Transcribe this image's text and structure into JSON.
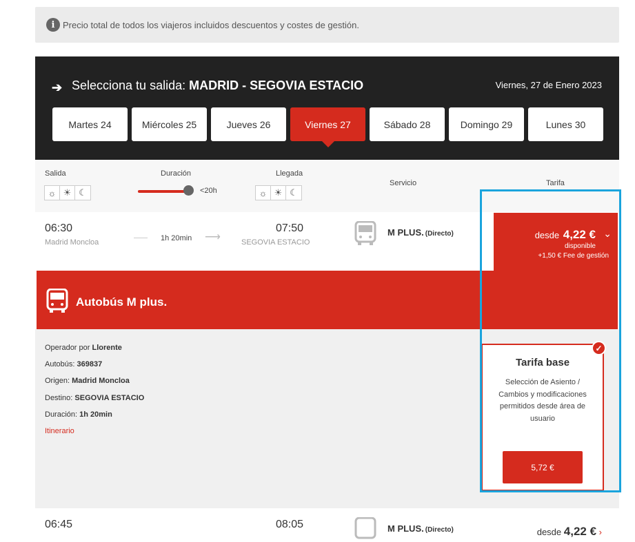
{
  "notice": {
    "icon": "info-icon",
    "text": "Precio total de todos los viajeros incluidos descuentos y costes de gestión."
  },
  "header": {
    "title_prefix": "Selecciona tu salida:",
    "title_route": "MADRID - SEGOVIA ESTACIO",
    "date": "Viernes, 27 de Enero 2023",
    "tabs": [
      {
        "label": "Martes 24"
      },
      {
        "label": "Miércoles 25"
      },
      {
        "label": "Jueves 26"
      },
      {
        "label": "Viernes 27"
      },
      {
        "label": "Sábado 28"
      },
      {
        "label": "Domingo 29"
      },
      {
        "label": "Lunes 30"
      }
    ],
    "active_tab": "Viernes 27"
  },
  "filters": {
    "salida": "Salida",
    "duracion": "Duración",
    "duracion_value": "<20h",
    "llegada": "Llegada",
    "servicio": "Servicio",
    "tarifa": "Tarifa"
  },
  "trip1": {
    "dep_time": "06:30",
    "dep_place": "Madrid Moncloa",
    "duration": "1h 20min",
    "arr_time": "07:50",
    "arr_place": "SEGOVIA ESTACIO",
    "service": "M PLUS.",
    "service_type": "(Directo)",
    "price_prefix": "desde",
    "price": "4,22 €",
    "availability": "disponible",
    "fee": "+1,50 € Fee de gestión"
  },
  "banner": {
    "label": "Autobús M plus."
  },
  "details": {
    "operator_label": "Operador por",
    "operator": "Llorente",
    "bus_label": "Autobús:",
    "bus": "369837",
    "origin_label": "Origen:",
    "origin": "Madrid Moncloa",
    "dest_label": "Destino:",
    "dest": "SEGOVIA ESTACIO",
    "dur_label": "Duración:",
    "dur": "1h 20min",
    "itinerary": "Itinerario"
  },
  "fare_card": {
    "title": "Tarifa base",
    "description": "Selección de Asiento / Cambios y modificaciones permitidos desde área de usuario",
    "price_button": "5,72 €"
  },
  "trip2": {
    "dep_time": "06:45",
    "arr_time": "08:05",
    "service": "M PLUS.",
    "service_type": "(Directo)",
    "price_prefix": "desde",
    "price": "4,22 €"
  },
  "colors": {
    "accent": "#d52b1e",
    "dark": "#222222",
    "highlight": "#1aa4dd"
  }
}
